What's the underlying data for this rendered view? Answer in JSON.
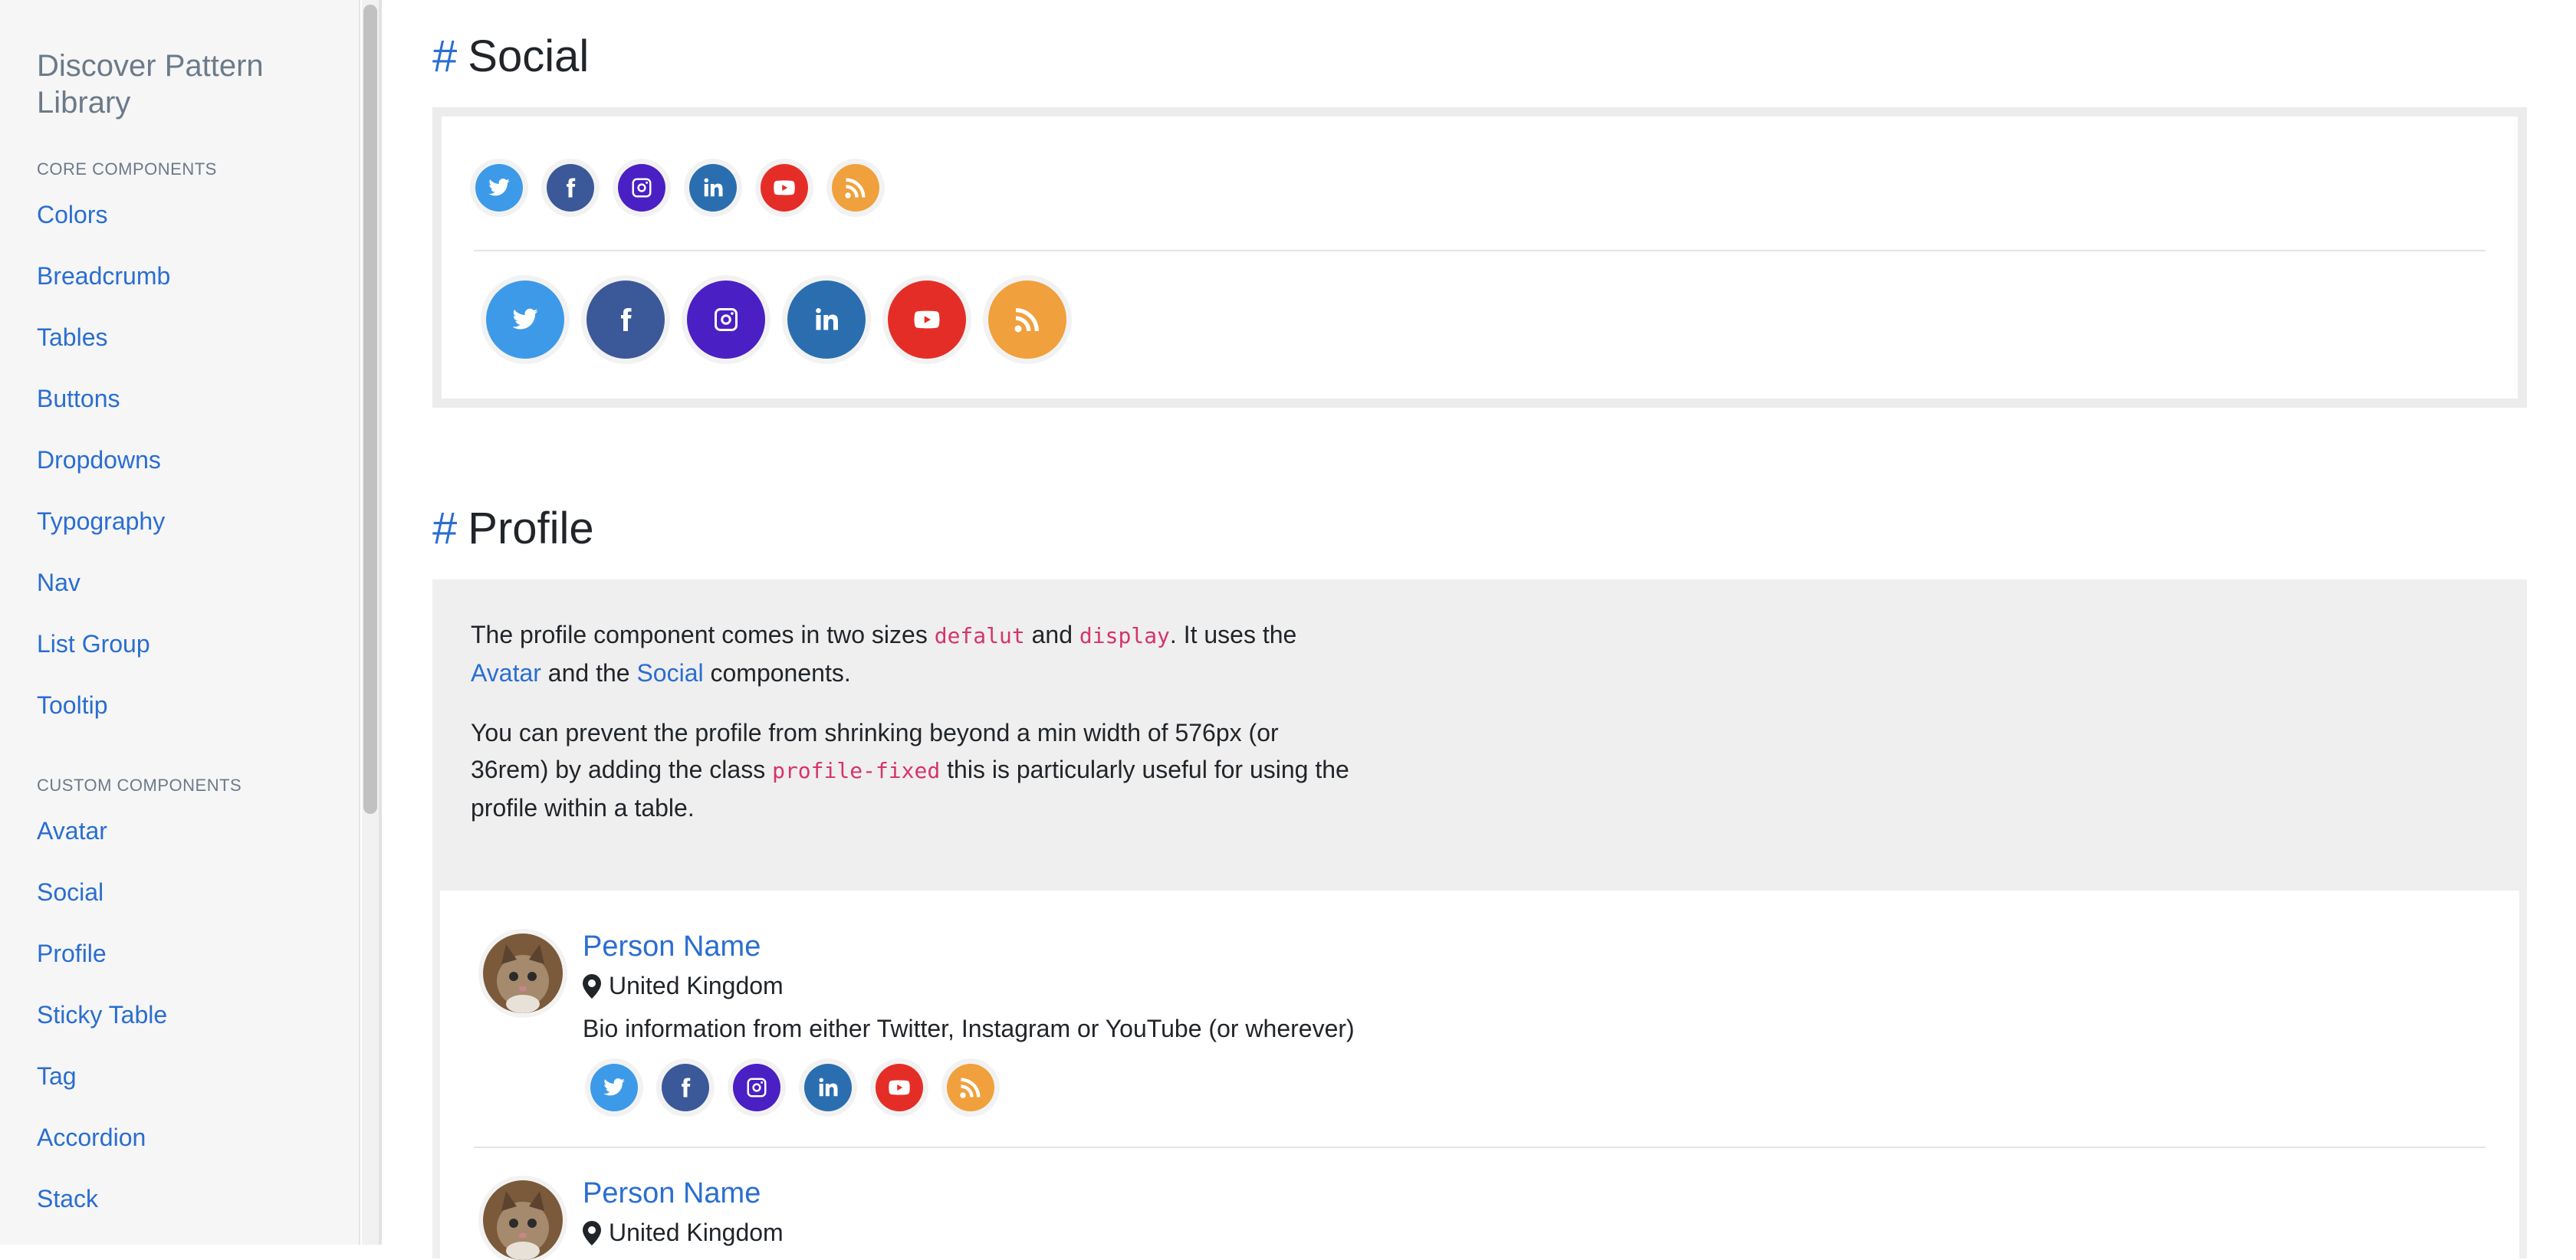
{
  "sidebar": {
    "brand": "Discover Pattern Library",
    "sections": [
      {
        "heading": "CORE COMPONENTS",
        "items": [
          "Colors",
          "Breadcrumb",
          "Tables",
          "Buttons",
          "Dropdowns",
          "Typography",
          "Nav",
          "List Group",
          "Tooltip"
        ]
      },
      {
        "heading": "CUSTOM COMPONENTS",
        "items": [
          "Avatar",
          "Social",
          "Profile",
          "Sticky Table",
          "Tag",
          "Accordion",
          "Stack"
        ]
      }
    ]
  },
  "social": {
    "heading": "Social",
    "hash": "#",
    "icons": [
      {
        "name": "twitter-icon",
        "color": "#3d9ae8"
      },
      {
        "name": "facebook-icon",
        "color": "#3b5998"
      },
      {
        "name": "instagram-icon",
        "color": "#4a1fc4"
      },
      {
        "name": "linkedin-icon",
        "color": "#2a6eb0"
      },
      {
        "name": "youtube-icon",
        "color": "#e52d27"
      },
      {
        "name": "rss-icon",
        "color": "#f0a03c"
      }
    ]
  },
  "profile": {
    "heading": "Profile",
    "hash": "#",
    "intro": {
      "p1_a": "The profile component comes in two sizes ",
      "code_default": "defalut",
      "p1_and": " and ",
      "code_display": "display",
      "p1_b": ". It uses the ",
      "avatar_link": "Avatar",
      "p1_c": " and the ",
      "social_link": "Social",
      "p1_d": " components.",
      "p2_a": "You can prevent the profile from shrinking beyond a min width of 576px (or 36rem) by adding the class ",
      "code_fixed": "profile-fixed",
      "p2_b": " this is particularly useful for using the profile within a table."
    },
    "people": [
      {
        "name": "Person Name",
        "location": "United Kingdom",
        "bio": "Bio information from either Twitter, Instagram or YouTube (or wherever)"
      },
      {
        "name": "Person Name",
        "location": "United Kingdom",
        "bio": ""
      }
    ]
  }
}
